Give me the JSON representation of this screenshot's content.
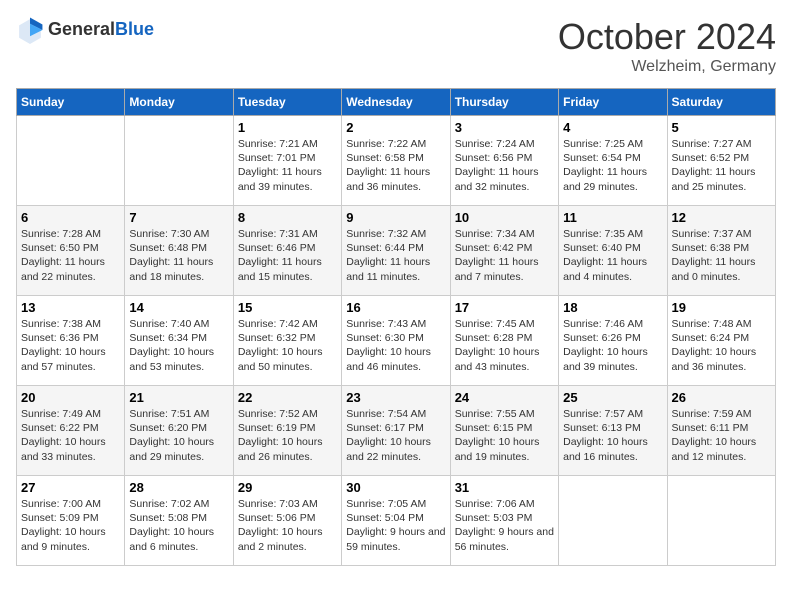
{
  "header": {
    "logo_line1": "General",
    "logo_line2": "Blue",
    "month": "October 2024",
    "location": "Welzheim, Germany"
  },
  "weekdays": [
    "Sunday",
    "Monday",
    "Tuesday",
    "Wednesday",
    "Thursday",
    "Friday",
    "Saturday"
  ],
  "weeks": [
    [
      {
        "day": "",
        "sunrise": "",
        "sunset": "",
        "daylight": ""
      },
      {
        "day": "",
        "sunrise": "",
        "sunset": "",
        "daylight": ""
      },
      {
        "day": "1",
        "sunrise": "Sunrise: 7:21 AM",
        "sunset": "Sunset: 7:01 PM",
        "daylight": "Daylight: 11 hours and 39 minutes."
      },
      {
        "day": "2",
        "sunrise": "Sunrise: 7:22 AM",
        "sunset": "Sunset: 6:58 PM",
        "daylight": "Daylight: 11 hours and 36 minutes."
      },
      {
        "day": "3",
        "sunrise": "Sunrise: 7:24 AM",
        "sunset": "Sunset: 6:56 PM",
        "daylight": "Daylight: 11 hours and 32 minutes."
      },
      {
        "day": "4",
        "sunrise": "Sunrise: 7:25 AM",
        "sunset": "Sunset: 6:54 PM",
        "daylight": "Daylight: 11 hours and 29 minutes."
      },
      {
        "day": "5",
        "sunrise": "Sunrise: 7:27 AM",
        "sunset": "Sunset: 6:52 PM",
        "daylight": "Daylight: 11 hours and 25 minutes."
      }
    ],
    [
      {
        "day": "6",
        "sunrise": "Sunrise: 7:28 AM",
        "sunset": "Sunset: 6:50 PM",
        "daylight": "Daylight: 11 hours and 22 minutes."
      },
      {
        "day": "7",
        "sunrise": "Sunrise: 7:30 AM",
        "sunset": "Sunset: 6:48 PM",
        "daylight": "Daylight: 11 hours and 18 minutes."
      },
      {
        "day": "8",
        "sunrise": "Sunrise: 7:31 AM",
        "sunset": "Sunset: 6:46 PM",
        "daylight": "Daylight: 11 hours and 15 minutes."
      },
      {
        "day": "9",
        "sunrise": "Sunrise: 7:32 AM",
        "sunset": "Sunset: 6:44 PM",
        "daylight": "Daylight: 11 hours and 11 minutes."
      },
      {
        "day": "10",
        "sunrise": "Sunrise: 7:34 AM",
        "sunset": "Sunset: 6:42 PM",
        "daylight": "Daylight: 11 hours and 7 minutes."
      },
      {
        "day": "11",
        "sunrise": "Sunrise: 7:35 AM",
        "sunset": "Sunset: 6:40 PM",
        "daylight": "Daylight: 11 hours and 4 minutes."
      },
      {
        "day": "12",
        "sunrise": "Sunrise: 7:37 AM",
        "sunset": "Sunset: 6:38 PM",
        "daylight": "Daylight: 11 hours and 0 minutes."
      }
    ],
    [
      {
        "day": "13",
        "sunrise": "Sunrise: 7:38 AM",
        "sunset": "Sunset: 6:36 PM",
        "daylight": "Daylight: 10 hours and 57 minutes."
      },
      {
        "day": "14",
        "sunrise": "Sunrise: 7:40 AM",
        "sunset": "Sunset: 6:34 PM",
        "daylight": "Daylight: 10 hours and 53 minutes."
      },
      {
        "day": "15",
        "sunrise": "Sunrise: 7:42 AM",
        "sunset": "Sunset: 6:32 PM",
        "daylight": "Daylight: 10 hours and 50 minutes."
      },
      {
        "day": "16",
        "sunrise": "Sunrise: 7:43 AM",
        "sunset": "Sunset: 6:30 PM",
        "daylight": "Daylight: 10 hours and 46 minutes."
      },
      {
        "day": "17",
        "sunrise": "Sunrise: 7:45 AM",
        "sunset": "Sunset: 6:28 PM",
        "daylight": "Daylight: 10 hours and 43 minutes."
      },
      {
        "day": "18",
        "sunrise": "Sunrise: 7:46 AM",
        "sunset": "Sunset: 6:26 PM",
        "daylight": "Daylight: 10 hours and 39 minutes."
      },
      {
        "day": "19",
        "sunrise": "Sunrise: 7:48 AM",
        "sunset": "Sunset: 6:24 PM",
        "daylight": "Daylight: 10 hours and 36 minutes."
      }
    ],
    [
      {
        "day": "20",
        "sunrise": "Sunrise: 7:49 AM",
        "sunset": "Sunset: 6:22 PM",
        "daylight": "Daylight: 10 hours and 33 minutes."
      },
      {
        "day": "21",
        "sunrise": "Sunrise: 7:51 AM",
        "sunset": "Sunset: 6:20 PM",
        "daylight": "Daylight: 10 hours and 29 minutes."
      },
      {
        "day": "22",
        "sunrise": "Sunrise: 7:52 AM",
        "sunset": "Sunset: 6:19 PM",
        "daylight": "Daylight: 10 hours and 26 minutes."
      },
      {
        "day": "23",
        "sunrise": "Sunrise: 7:54 AM",
        "sunset": "Sunset: 6:17 PM",
        "daylight": "Daylight: 10 hours and 22 minutes."
      },
      {
        "day": "24",
        "sunrise": "Sunrise: 7:55 AM",
        "sunset": "Sunset: 6:15 PM",
        "daylight": "Daylight: 10 hours and 19 minutes."
      },
      {
        "day": "25",
        "sunrise": "Sunrise: 7:57 AM",
        "sunset": "Sunset: 6:13 PM",
        "daylight": "Daylight: 10 hours and 16 minutes."
      },
      {
        "day": "26",
        "sunrise": "Sunrise: 7:59 AM",
        "sunset": "Sunset: 6:11 PM",
        "daylight": "Daylight: 10 hours and 12 minutes."
      }
    ],
    [
      {
        "day": "27",
        "sunrise": "Sunrise: 7:00 AM",
        "sunset": "Sunset: 5:09 PM",
        "daylight": "Daylight: 10 hours and 9 minutes."
      },
      {
        "day": "28",
        "sunrise": "Sunrise: 7:02 AM",
        "sunset": "Sunset: 5:08 PM",
        "daylight": "Daylight: 10 hours and 6 minutes."
      },
      {
        "day": "29",
        "sunrise": "Sunrise: 7:03 AM",
        "sunset": "Sunset: 5:06 PM",
        "daylight": "Daylight: 10 hours and 2 minutes."
      },
      {
        "day": "30",
        "sunrise": "Sunrise: 7:05 AM",
        "sunset": "Sunset: 5:04 PM",
        "daylight": "Daylight: 9 hours and 59 minutes."
      },
      {
        "day": "31",
        "sunrise": "Sunrise: 7:06 AM",
        "sunset": "Sunset: 5:03 PM",
        "daylight": "Daylight: 9 hours and 56 minutes."
      },
      {
        "day": "",
        "sunrise": "",
        "sunset": "",
        "daylight": ""
      },
      {
        "day": "",
        "sunrise": "",
        "sunset": "",
        "daylight": ""
      }
    ]
  ]
}
